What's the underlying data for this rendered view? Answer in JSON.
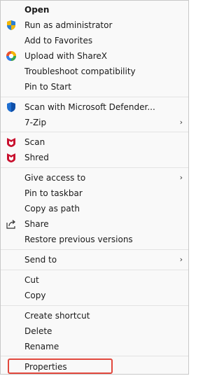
{
  "menu": {
    "open": "Open",
    "run_admin": "Run as administrator",
    "add_favorites": "Add to Favorites",
    "sharex": "Upload with ShareX",
    "troubleshoot": "Troubleshoot compatibility",
    "pin_start": "Pin to Start",
    "defender": "Scan with Microsoft Defender...",
    "zip": "7-Zip",
    "scan": "Scan",
    "shred": "Shred",
    "give_access": "Give access to",
    "pin_taskbar": "Pin to taskbar",
    "copy_path": "Copy as path",
    "share": "Share",
    "restore": "Restore previous versions",
    "send_to": "Send to",
    "cut": "Cut",
    "copy": "Copy",
    "create_shortcut": "Create shortcut",
    "delete": "Delete",
    "rename": "Rename",
    "properties": "Properties"
  },
  "colors": {
    "highlight_border": "#e2483d",
    "mcafee_red": "#c8102e",
    "defender_blue": "#1f6fd1"
  },
  "icons": {
    "run_admin": "uac-shield-icon",
    "sharex": "sharex-icon",
    "defender": "defender-shield-icon",
    "scan": "mcafee-icon",
    "shred": "mcafee-icon",
    "share": "share-icon",
    "submenu": "chevron-right-icon"
  }
}
